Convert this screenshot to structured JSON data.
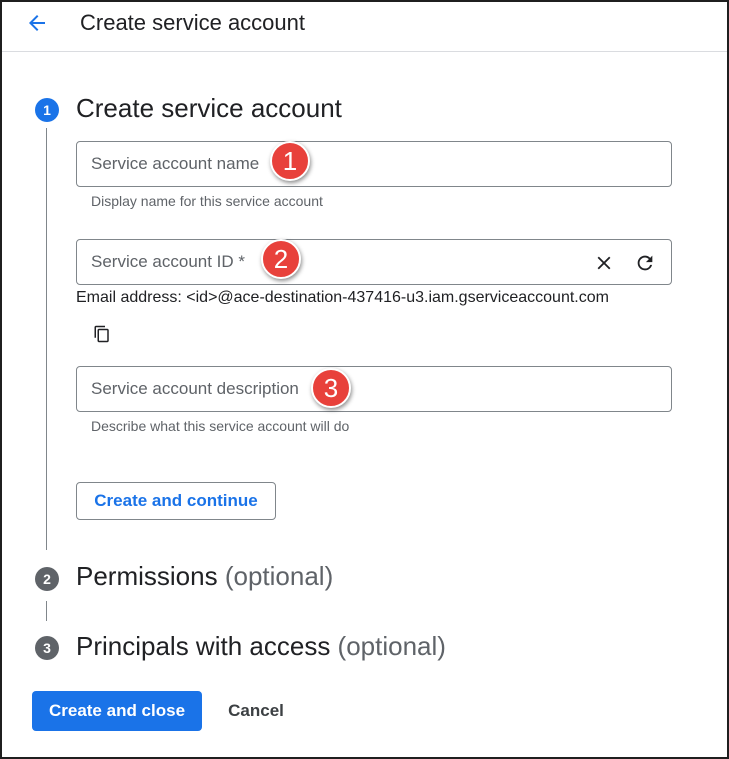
{
  "header": {
    "title": "Create service account",
    "back_icon": "arrow-back-icon"
  },
  "steps": [
    {
      "number": "1",
      "title": "Create service account",
      "optional": "",
      "state": "active"
    },
    {
      "number": "2",
      "title": "Permissions",
      "optional": "(optional)",
      "state": "inactive"
    },
    {
      "number": "3",
      "title": "Principals with access",
      "optional": "(optional)",
      "state": "inactive"
    }
  ],
  "form": {
    "name": {
      "placeholder": "Service account name",
      "value": "",
      "hint": "Display name for this service account"
    },
    "id": {
      "placeholder": "Service account ID *",
      "value": "",
      "clear_icon": "close-icon",
      "refresh_icon": "refresh-icon"
    },
    "email": {
      "text": "Email address: <id>@ace-destination-437416-u3.iam.gserviceaccount.com",
      "copy_icon": "copy-icon"
    },
    "description": {
      "placeholder": "Service account description",
      "value": "",
      "hint": "Describe what this service account will do"
    },
    "continue_label": "Create and continue"
  },
  "footer": {
    "create_close_label": "Create and close",
    "cancel_label": "Cancel"
  },
  "annotations": [
    "1",
    "2",
    "3"
  ],
  "colors": {
    "accent": "#1a73e8",
    "step_inactive": "#5f6368",
    "annotation": "#e8413b",
    "border": "#80868b"
  }
}
